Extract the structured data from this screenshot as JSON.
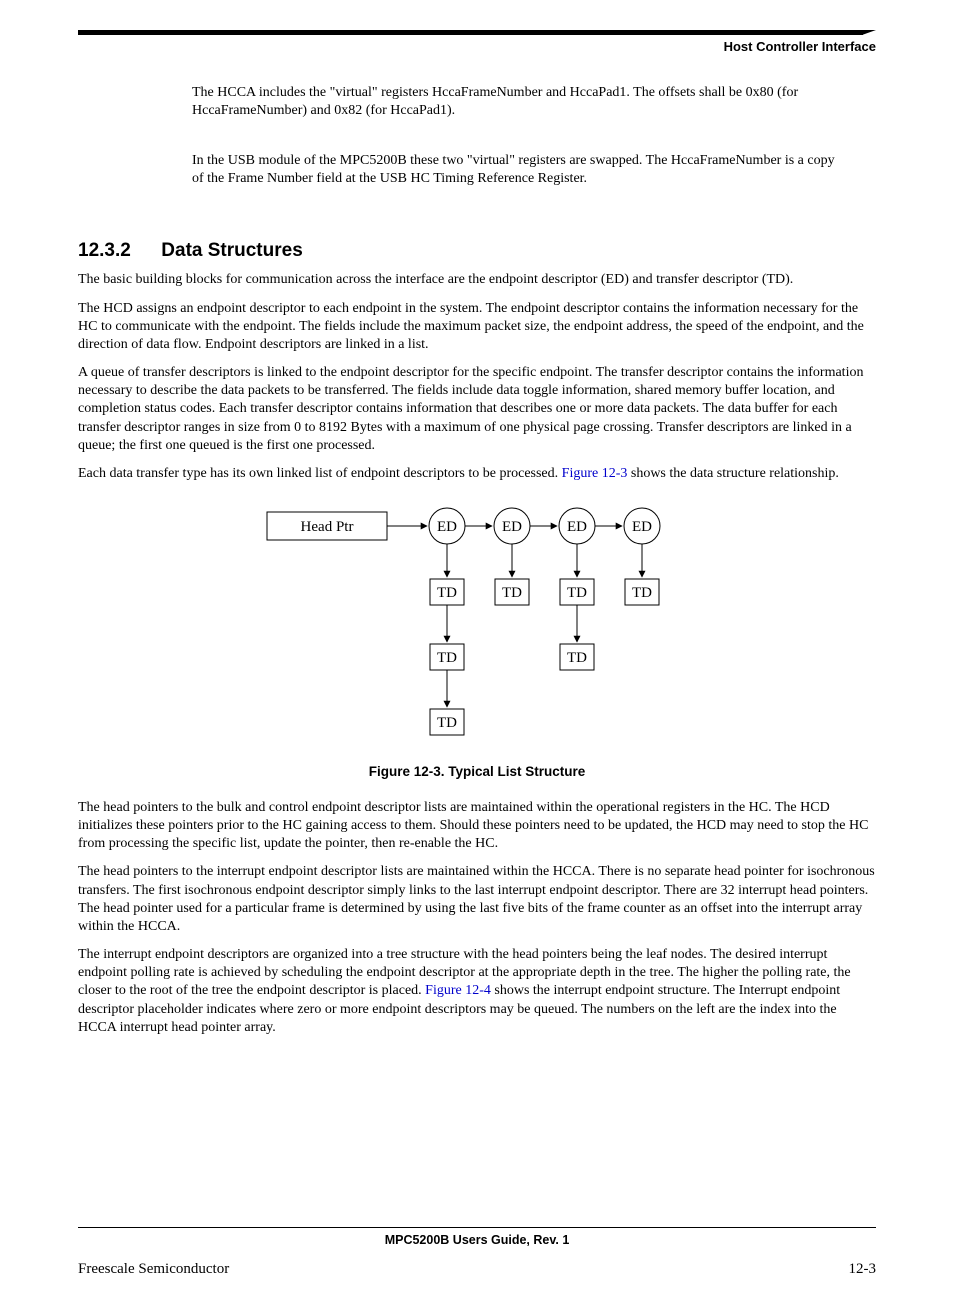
{
  "header": {
    "section_title": "Host Controller Interface"
  },
  "intro": {
    "p1": "The HCCA includes the \"virtual\" registers HccaFrameNumber and HccaPad1. The offsets shall be 0x80 (for HccaFrameNumber) and 0x82 (for HccaPad1).",
    "p2": "In the USB module of the MPC5200B these two \"virtual\" registers are swapped. The HccaFrameNumber is a copy of the Frame Number field at the USB HC Timing Reference Register."
  },
  "section": {
    "number": "12.3.2",
    "title": "Data Structures"
  },
  "body": {
    "p1": "The basic building blocks for communication across the interface are the endpoint descriptor (ED) and transfer descriptor (TD).",
    "p2": "The HCD assigns an endpoint descriptor to each endpoint in the system. The endpoint descriptor contains the information necessary for the HC to communicate with the endpoint. The fields include the maximum packet size, the endpoint address, the speed of the endpoint, and the direction of data flow. Endpoint descriptors are linked in a list.",
    "p3": "A queue of transfer descriptors is linked to the endpoint descriptor for the specific endpoint. The transfer descriptor contains the information necessary to describe the data packets to be transferred. The fields include data toggle information, shared memory buffer location, and completion status codes. Each transfer descriptor contains information that describes one or more data packets. The data buffer for each transfer descriptor ranges in size from 0 to 8192 Bytes with a maximum of one physical page crossing. Transfer descriptors are linked in a queue; the first one queued is the first one processed.",
    "p4_a": "Each data transfer type has its own linked list of endpoint descriptors to be processed. ",
    "p4_link": "Figure 12-3",
    "p4_b": " shows the data structure relationship.",
    "p5": "The head pointers to the bulk and control endpoint descriptor lists are maintained within the operational registers in the HC. The HCD initializes these pointers prior to the HC gaining access to them. Should these pointers need to be updated, the HCD may need to stop the HC from processing the specific list, update the pointer, then re-enable the HC.",
    "p6": "The head pointers to the interrupt endpoint descriptor lists are maintained within the HCCA. There is no separate head pointer for isochronous transfers. The first isochronous endpoint descriptor simply links to the last interrupt endpoint descriptor. There are 32 interrupt head pointers. The head pointer used for a particular frame is determined by using the last five bits of the frame counter as an offset into the interrupt array within the HCCA.",
    "p7_a": "The interrupt endpoint descriptors are organized into a tree structure with the head pointers being the leaf nodes. The desired interrupt endpoint polling rate is achieved by scheduling the endpoint descriptor at the appropriate depth in the tree. The higher the polling rate, the closer to the root of the tree the endpoint descriptor is placed. ",
    "p7_link": "Figure 12-4",
    "p7_b": " shows the interrupt endpoint structure. The Interrupt endpoint descriptor placeholder indicates where zero or more endpoint descriptors may be queued. The numbers on the left are the index into the HCCA interrupt head pointer array."
  },
  "figure": {
    "caption": "Figure 12-3. Typical List Structure",
    "head_ptr": "Head Ptr",
    "ed": "ED",
    "td": "TD"
  },
  "footer": {
    "guide": "MPC5200B Users Guide, Rev. 1",
    "left": "Freescale Semiconductor",
    "right": "12-3"
  }
}
